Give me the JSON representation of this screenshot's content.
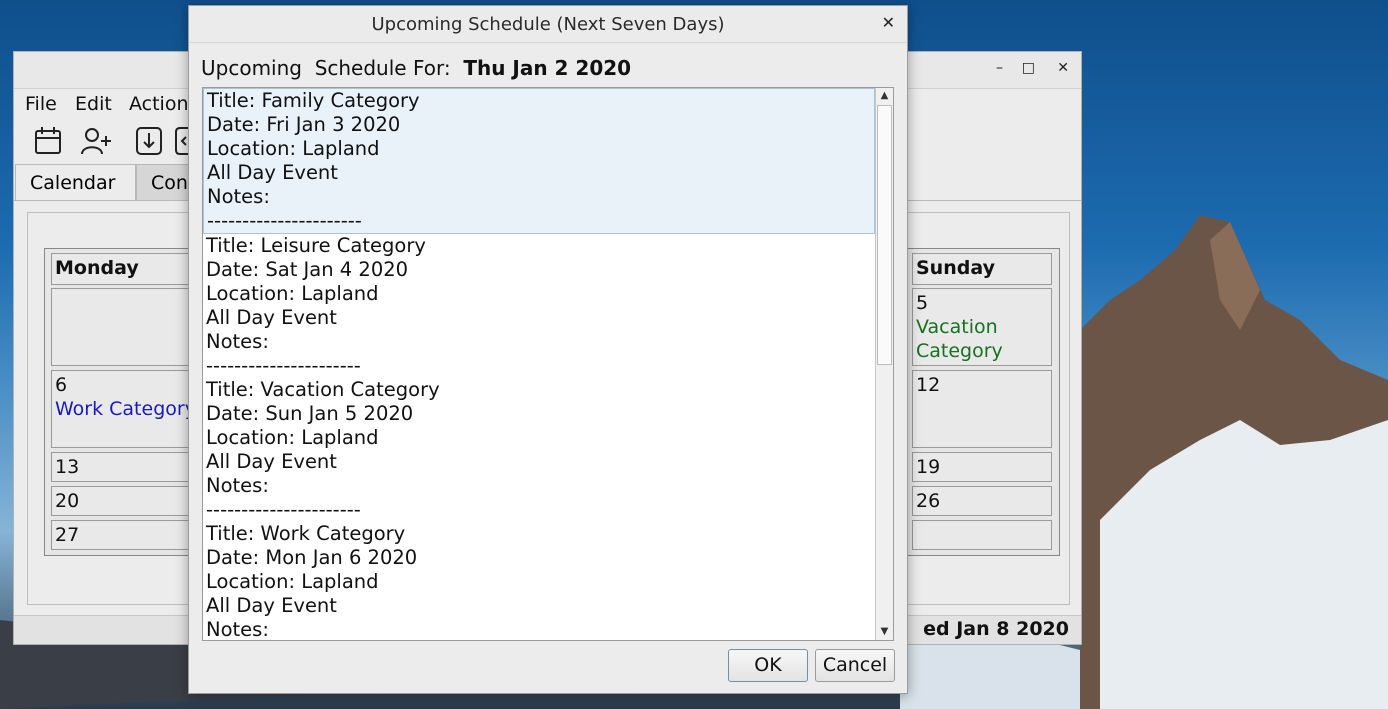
{
  "dialog": {
    "title": "Upcoming Schedule (Next Seven Days)",
    "header_label": "Upcoming  Schedule For:",
    "header_date": "Thu Jan 2 2020",
    "ok_label": "OK",
    "cancel_label": "Cancel",
    "entries": [
      {
        "title": "Title: Family Category",
        "date": "Date: Fri Jan 3 2020",
        "location": "Location: Lapland",
        "allday": "All Day Event",
        "notes": "Notes:",
        "sep": "----------------------"
      },
      {
        "title": "Title: Leisure Category",
        "date": "Date: Sat Jan 4 2020",
        "location": "Location: Lapland",
        "allday": "All Day Event",
        "notes": "Notes:",
        "sep": "----------------------"
      },
      {
        "title": "Title: Vacation Category",
        "date": "Date: Sun Jan 5 2020",
        "location": "Location: Lapland",
        "allday": "All Day Event",
        "notes": "Notes:",
        "sep": "----------------------"
      },
      {
        "title": "Title: Work Category",
        "date": "Date: Mon Jan 6 2020",
        "location": "Location: Lapland",
        "allday": "All Day Event",
        "notes": "Notes:"
      }
    ]
  },
  "main": {
    "menu": [
      "File",
      "Edit",
      "Action"
    ],
    "tabs": [
      "Calendar",
      "Con"
    ],
    "calendar": {
      "monday_header": "Monday",
      "sunday_header": "Sunday",
      "monday_cells": [
        {
          "day": "",
          "event": ""
        },
        {
          "day": "6",
          "event": "Work Category"
        },
        {
          "day": "13",
          "event": ""
        },
        {
          "day": "20",
          "event": ""
        },
        {
          "day": "27",
          "event": ""
        }
      ],
      "sunday_cells": [
        {
          "day": "5",
          "event": "Vacation Category"
        },
        {
          "day": "12",
          "event": ""
        },
        {
          "day": "19",
          "event": ""
        },
        {
          "day": "26",
          "event": ""
        },
        {
          "day": "",
          "event": ""
        }
      ]
    },
    "status_date": "ed Jan 8 2020"
  },
  "colors": {
    "work_event": "#1a1ab8",
    "vacation_event": "#17701f",
    "selection": "#e9f2f9"
  }
}
